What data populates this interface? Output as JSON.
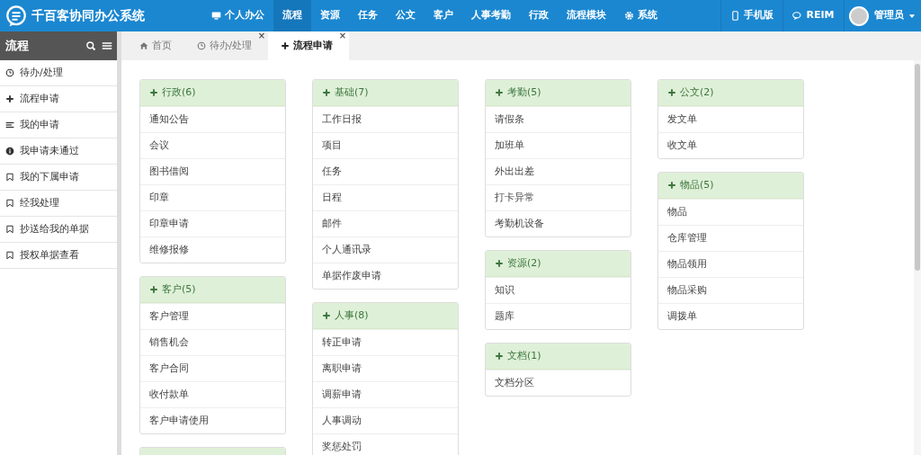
{
  "app": {
    "title": "千百客协同办公系统"
  },
  "nav": [
    {
      "label": "个人办公",
      "selected": false
    },
    {
      "label": "流程",
      "selected": true
    },
    {
      "label": "资源",
      "selected": false
    },
    {
      "label": "任务",
      "selected": false
    },
    {
      "label": "公文",
      "selected": false
    },
    {
      "label": "客户",
      "selected": false
    },
    {
      "label": "人事考勤",
      "selected": false
    },
    {
      "label": "行政",
      "selected": false
    },
    {
      "label": "流程模块",
      "selected": false
    },
    {
      "label": "系统",
      "selected": false
    }
  ],
  "nav_right": [
    {
      "label": "手机版"
    },
    {
      "label": "REIM"
    }
  ],
  "user": {
    "name": "管理员"
  },
  "sidebar": {
    "title": "流程",
    "items": [
      {
        "label": "待办/处理"
      },
      {
        "label": "流程申请"
      },
      {
        "label": "我的申请"
      },
      {
        "label": "我申请未通过"
      },
      {
        "label": "我的下属申请"
      },
      {
        "label": "经我处理"
      },
      {
        "label": "抄送给我的单据"
      },
      {
        "label": "授权单据查看"
      }
    ]
  },
  "tabs": [
    {
      "label": "首页",
      "selected": false,
      "closable": false
    },
    {
      "label": "待办/处理",
      "selected": false,
      "closable": true,
      "close": "×"
    },
    {
      "label": "流程申请",
      "selected": true,
      "closable": true,
      "close": "×"
    }
  ],
  "columns": [
    {
      "panels": [
        {
          "kind": "full",
          "title": "行政(6)",
          "items": [
            "通知公告",
            "会议",
            "图书借阅",
            "印章",
            "印章申请",
            "维修报修"
          ]
        },
        {
          "kind": "full",
          "title": "客户(5)",
          "items": [
            "客户管理",
            "销售机会",
            "客户合同",
            "收付款单",
            "客户申请使用"
          ]
        },
        {
          "kind": "partial"
        }
      ]
    },
    {
      "panels": [
        {
          "kind": "full",
          "title": "基础(7)",
          "items": [
            "工作日报",
            "项目",
            "任务",
            "日程",
            "邮件",
            "个人通讯录",
            "单据作废申请"
          ]
        },
        {
          "kind": "full",
          "title": "人事(8)",
          "items": [
            "转正申请",
            "离职申请",
            "调薪申请",
            "人事调动",
            "奖惩处罚"
          ]
        }
      ]
    },
    {
      "panels": [
        {
          "kind": "full",
          "title": "考勤(5)",
          "items": [
            "请假条",
            "加班单",
            "外出出差",
            "打卡异常",
            "考勤机设备"
          ]
        },
        {
          "kind": "full",
          "title": "资源(2)",
          "items": [
            "知识",
            "题库"
          ]
        },
        {
          "kind": "full",
          "title": "文档(1)",
          "items": [
            "文档分区"
          ]
        }
      ]
    },
    {
      "panels": [
        {
          "kind": "full",
          "title": "公文(2)",
          "items": [
            "发文单",
            "收文单"
          ]
        },
        {
          "kind": "full",
          "title": "物品(5)",
          "items": [
            "物品",
            "仓库管理",
            "物品领用",
            "物品采购",
            "调拨单"
          ]
        }
      ]
    }
  ]
}
